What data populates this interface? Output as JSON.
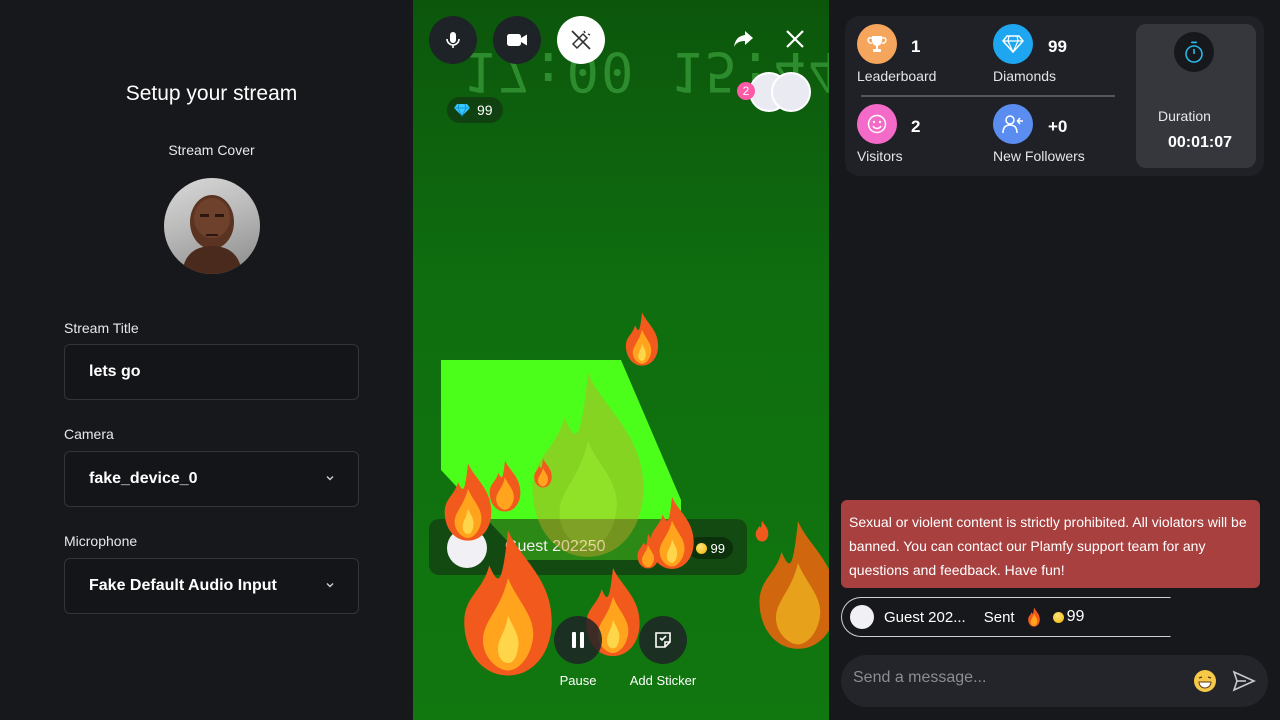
{
  "setup": {
    "title": "Setup your stream",
    "cover_label": "Stream Cover",
    "title_label": "Stream Title",
    "title_value": "lets go",
    "camera_label": "Camera",
    "camera_value": "fake_device_0",
    "mic_label": "Microphone",
    "mic_value": "Fake Default Audio Input"
  },
  "stream": {
    "clock_overlay": "17:00 15:44",
    "diamonds": "99",
    "viewer_badge": "2",
    "gift_user": "Guest 202250",
    "gift_coins": "99",
    "pause_label": "Pause",
    "sticker_label": "Add Sticker"
  },
  "stats": {
    "leaderboard_num": "1",
    "leaderboard_label": "Leaderboard",
    "diamonds_num": "99",
    "diamonds_label": "Diamonds",
    "visitors_num": "2",
    "visitors_label": "Visitors",
    "followers_num": "+0",
    "followers_label": "New Followers",
    "duration_label": "Duration",
    "duration_value": "00:01:07"
  },
  "chat": {
    "rules": "Sexual or violent content is strictly prohibited. All violators will be banned. You can contact our Plamfy support team for any questions and feedback. Have fun!",
    "gift_user": "Guest 202...",
    "gift_sent": "Sent",
    "gift_amount": "99",
    "placeholder": "Send a message..."
  },
  "colors": {
    "leaderboard": "#f6a55c",
    "diamonds": "#1fa6f0",
    "visitors": "#f36ac8",
    "followers": "#5b8cf0",
    "rules_bg": "#a7403f",
    "stream_green": "#0f6e0f"
  }
}
